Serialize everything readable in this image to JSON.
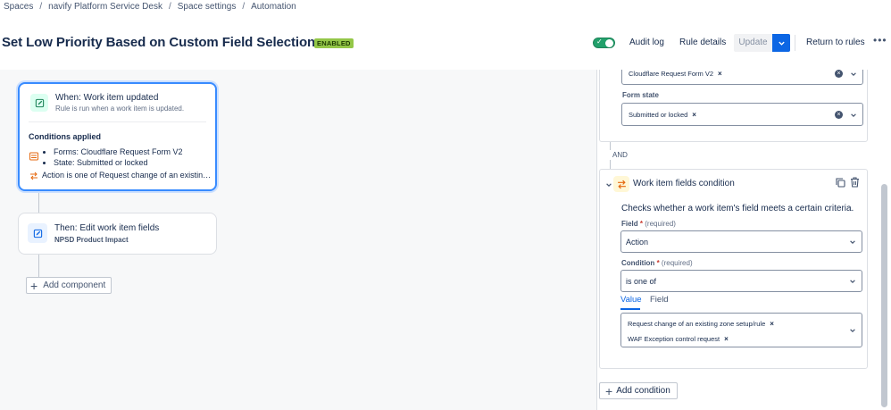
{
  "breadcrumb": [
    "Spaces",
    "navify Platform Service Desk",
    "Space settings",
    "Automation"
  ],
  "header": {
    "title": "Set Low Priority Based on Custom Field Selection",
    "status_badge": "ENABLED",
    "enabled": true,
    "audit_log": "Audit log",
    "rule_details": "Rule details",
    "update": "Update",
    "return_to_rules": "Return to rules",
    "more": "•••"
  },
  "canvas": {
    "trigger": {
      "title": "When: Work item updated",
      "subtitle": "Rule is run when a work item is updated.",
      "conditions_title": "Conditions applied",
      "conditions": [
        "Forms: Cloudflare Request Form V2",
        "State: Submitted or locked"
      ],
      "action_condition": "Action is one of Request change of an existing zone setup/rule, WAF Exception control request"
    },
    "action": {
      "title": "Then: Edit work item fields",
      "subtitle": "NPSD Product Impact"
    },
    "add_component": "Add component"
  },
  "panel": {
    "forms_tag": "Cloudflare Request Form V2",
    "form_state_label": "Form state",
    "form_state_tag": "Submitted or locked",
    "and_label": "AND",
    "condition": {
      "title": "Work item fields condition",
      "description": "Checks whether a work item's field meets a certain criteria.",
      "field_label": "Field",
      "required_text": "(required)",
      "field_value": "Action",
      "condition_label": "Condition",
      "condition_value": "is one of",
      "tabs": [
        "Value",
        "Field"
      ],
      "values": [
        "Request change of an existing zone setup/rule",
        "WAF Exception control request"
      ]
    },
    "add_condition": "Add condition"
  },
  "colors": {
    "accent": "#0c66e4",
    "enabled_badge": "#94c748",
    "toggle_on": "#22a06b"
  }
}
